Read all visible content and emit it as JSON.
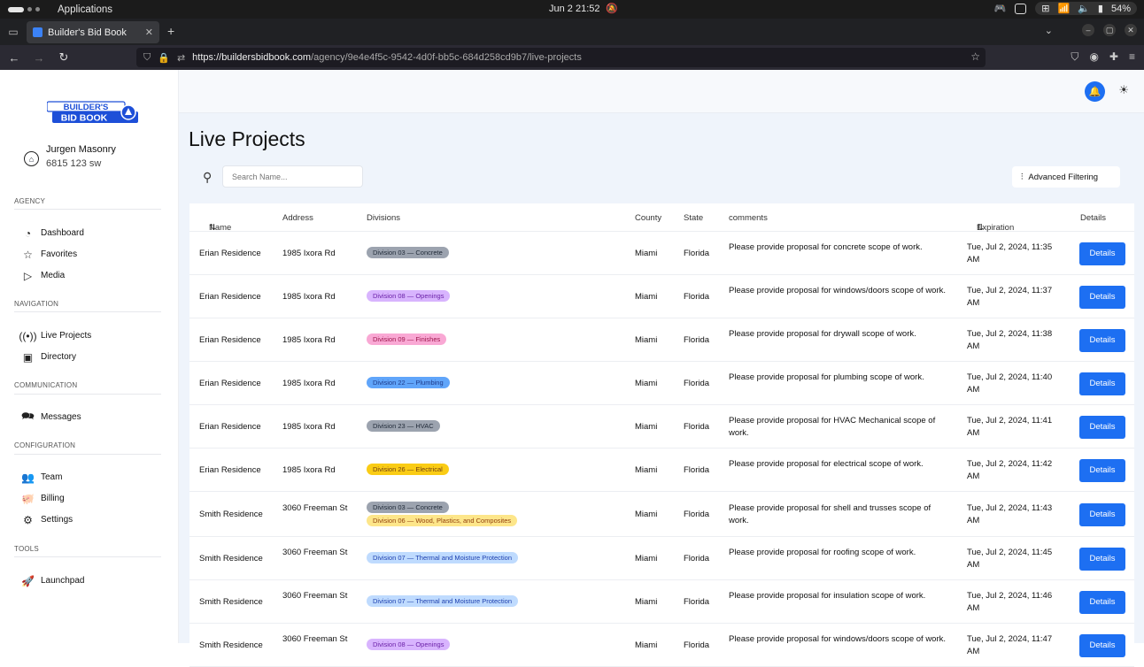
{
  "os": {
    "activities": "Applications",
    "clock": "Jun 2  21:52",
    "battery": "54%"
  },
  "browser": {
    "tab_title": "Builder's Bid Book",
    "url_host": "https://buildersbidbook.com",
    "url_path": "/agency/9e4e4f5c-9542-4d0f-bb5c-684d258cd9b7/live-projects"
  },
  "sidebar": {
    "user_name": "Jurgen Masonry",
    "user_address": "6815 123 sw",
    "sections": [
      {
        "label": "AGENCY",
        "items": [
          {
            "label": "Dashboard",
            "icon": "pie-chart-icon"
          },
          {
            "label": "Favorites",
            "icon": "star-icon"
          },
          {
            "label": "Media",
            "icon": "play-icon"
          }
        ]
      },
      {
        "label": "NAVIGATION",
        "items": [
          {
            "label": "Live Projects",
            "icon": "broadcast-icon"
          },
          {
            "label": "Directory",
            "icon": "contact-book-icon"
          }
        ]
      },
      {
        "label": "COMMUNICATION",
        "items": [
          {
            "label": "Messages",
            "icon": "messages-icon"
          }
        ]
      },
      {
        "label": "CONFIGURATION",
        "items": [
          {
            "label": "Team",
            "icon": "users-icon"
          },
          {
            "label": "Billing",
            "icon": "piggy-bank-icon"
          },
          {
            "label": "Settings",
            "icon": "gear-icon"
          }
        ]
      },
      {
        "label": "TOOLS",
        "items": [
          {
            "label": "Launchpad",
            "icon": "rocket-icon"
          }
        ]
      }
    ]
  },
  "main": {
    "title": "Live Projects",
    "search_placeholder": "Search Name...",
    "advanced_filtering": "Advanced Filtering",
    "columns": {
      "name": "Name",
      "address": "Address",
      "divisions": "Divisions",
      "county": "County",
      "state": "State",
      "comments": "comments",
      "expiration": "Expiration",
      "details": "Details"
    },
    "rows": [
      {
        "name": "Erian Residence",
        "address": "1985 Ixora Rd",
        "divisions": [
          {
            "label": "Division 03 — Concrete",
            "bg": "#9ca3af",
            "fg": "#1f2937"
          }
        ],
        "county": "Miami",
        "state": "Florida",
        "comment": "Please provide proposal for concrete scope of work.",
        "expiration": "Tue, Jul 2, 2024, 11:35 AM",
        "button": "Details"
      },
      {
        "name": "Erian Residence",
        "address": "1985 Ixora Rd",
        "divisions": [
          {
            "label": "Division 08 — Openings",
            "bg": "#d8b4fe",
            "fg": "#6b21a8"
          }
        ],
        "county": "Miami",
        "state": "Florida",
        "comment": "Please provide proposal for windows/doors scope of work.",
        "expiration": "Tue, Jul 2, 2024, 11:37 AM",
        "button": "Details"
      },
      {
        "name": "Erian Residence",
        "address": "1985 Ixora Rd",
        "divisions": [
          {
            "label": "Division 09 — Finishes",
            "bg": "#f9a8d4",
            "fg": "#9d174d"
          }
        ],
        "county": "Miami",
        "state": "Florida",
        "comment": "Please provide proposal for drywall scope of work.",
        "expiration": "Tue, Jul 2, 2024, 11:38 AM",
        "button": "Details"
      },
      {
        "name": "Erian Residence",
        "address": "1985 Ixora Rd",
        "divisions": [
          {
            "label": "Division 22 — Plumbing",
            "bg": "#60a5fa",
            "fg": "#1e3a8a"
          }
        ],
        "county": "Miami",
        "state": "Florida",
        "comment": "Please provide proposal for plumbing scope of work.",
        "expiration": "Tue, Jul 2, 2024, 11:40 AM",
        "button": "Details"
      },
      {
        "name": "Erian Residence",
        "address": "1985 Ixora Rd",
        "divisions": [
          {
            "label": "Division 23 — HVAC",
            "bg": "#9ca3af",
            "fg": "#1f2937"
          }
        ],
        "county": "Miami",
        "state": "Florida",
        "comment": "Please provide proposal for HVAC Mechanical scope of work.",
        "expiration": "Tue, Jul 2, 2024, 11:41 AM",
        "button": "Details"
      },
      {
        "name": "Erian Residence",
        "address": "1985 Ixora Rd",
        "divisions": [
          {
            "label": "Division 26 — Electrical",
            "bg": "#facc15",
            "fg": "#713f12"
          }
        ],
        "county": "Miami",
        "state": "Florida",
        "comment": "Please provide proposal for electrical scope of work.",
        "expiration": "Tue, Jul 2, 2024, 11:42 AM",
        "button": "Details"
      },
      {
        "name": "Smith Residence",
        "address": "3060 Freeman St",
        "divisions": [
          {
            "label": "Division 03 — Concrete",
            "bg": "#9ca3af",
            "fg": "#1f2937"
          },
          {
            "label": "Division 06 — Wood, Plastics, and Composites",
            "bg": "#fde68a",
            "fg": "#92400e"
          }
        ],
        "county": "Miami",
        "state": "Florida",
        "comment": "Please provide proposal for shell and trusses scope of work.",
        "expiration": "Tue, Jul 2, 2024, 11:43 AM",
        "button": "Details"
      },
      {
        "name": "Smith Residence",
        "address": "3060 Freeman St",
        "divisions": [
          {
            "label": "Division 07 — Thermal and Moisture Protection",
            "bg": "#bfdbfe",
            "fg": "#1e40af"
          }
        ],
        "county": "Miami",
        "state": "Florida",
        "comment": "Please provide proposal for roofing scope of work.",
        "expiration": "Tue, Jul 2, 2024, 11:45 AM",
        "button": "Details"
      },
      {
        "name": "Smith Residence",
        "address": "3060 Freeman St",
        "divisions": [
          {
            "label": "Division 07 — Thermal and Moisture Protection",
            "bg": "#bfdbfe",
            "fg": "#1e40af"
          }
        ],
        "county": "Miami",
        "state": "Florida",
        "comment": "Please provide proposal for insulation scope of work.",
        "expiration": "Tue, Jul 2, 2024, 11:46 AM",
        "button": "Details"
      },
      {
        "name": "Smith Residence",
        "address": "3060 Freeman St",
        "divisions": [
          {
            "label": "Division 08 — Openings",
            "bg": "#d8b4fe",
            "fg": "#6b21a8"
          }
        ],
        "county": "Miami",
        "state": "Florida",
        "comment": "Please provide proposal for windows/doors scope of work.",
        "expiration": "Tue, Jul 2, 2024, 11:47 AM",
        "button": "Details"
      }
    ]
  },
  "colors": {
    "accent": "#1d6ff2",
    "page_bg": "#eff4fb"
  }
}
